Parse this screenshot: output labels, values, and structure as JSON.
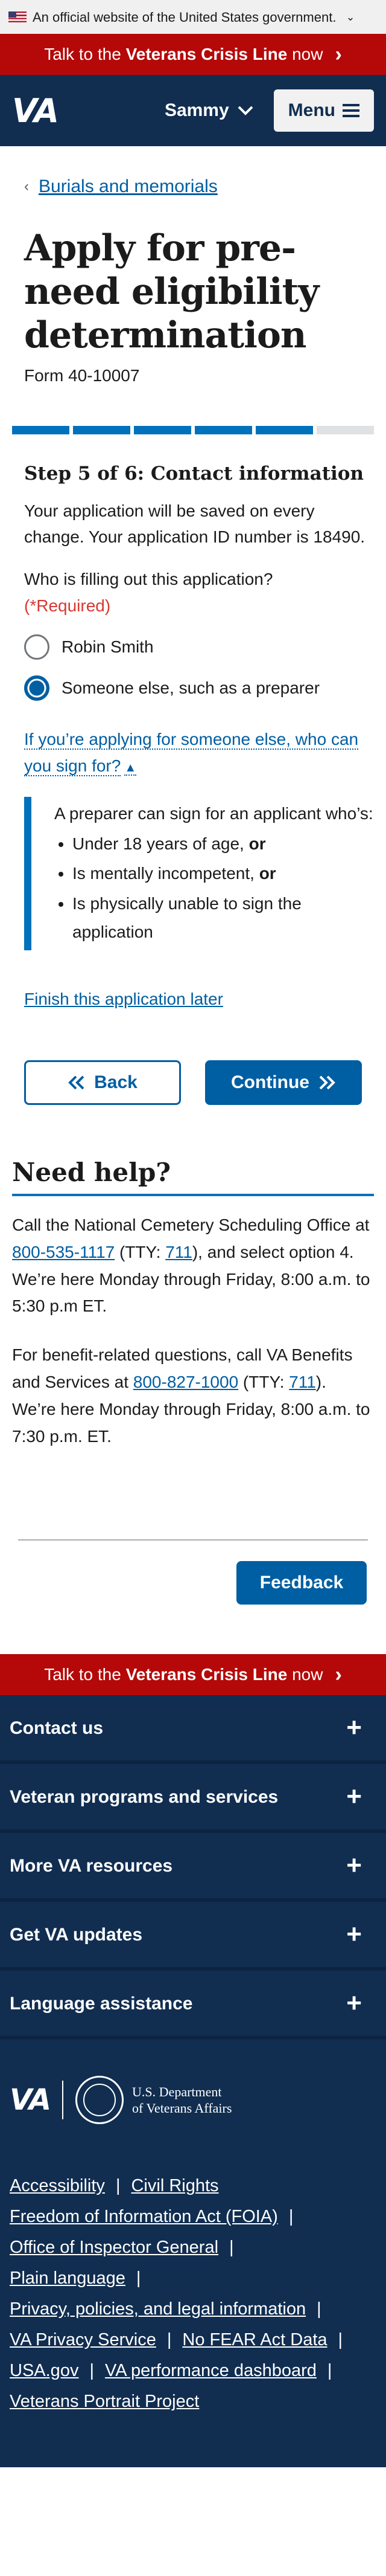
{
  "gov_banner": {
    "text": "An official website of the United States government."
  },
  "crisis": {
    "prefix": "Talk to the ",
    "strong": "Veterans Crisis Line",
    "suffix": " now"
  },
  "header": {
    "logo": "VA",
    "user_name": "Sammy",
    "menu_label": "Menu"
  },
  "breadcrumb": {
    "label": "Burials and memorials"
  },
  "page": {
    "title": "Apply for pre-need eligibility determination",
    "form_number": "Form 40-10007",
    "progress": {
      "current": 5,
      "total": 6
    },
    "step_heading": "Step 5 of 6: Contact information",
    "saved_text": "Your application will be saved on every change. Your application ID number is 18490.",
    "question": "Who is filling out this application?",
    "required": "(*Required)",
    "options": [
      "Robin Smith",
      "Someone else, such as a preparer"
    ],
    "selected_option": 1,
    "expander_label": "If you’re applying for someone else, who can you sign for?",
    "info": {
      "intro": "A preparer can sign for an applicant who’s:",
      "items": [
        {
          "text": "Under 18 years of age, ",
          "strong": "or"
        },
        {
          "text": "Is mentally incompetent, ",
          "strong": "or"
        },
        {
          "text": "Is physically unable to sign the application",
          "strong": ""
        }
      ]
    },
    "finish_later": "Finish this application later",
    "back_label": "Back",
    "continue_label": "Continue"
  },
  "help": {
    "title": "Need help?",
    "p1_a": "Call the National Cemetery Scheduling Office at ",
    "p1_phone": "800-535-1117",
    "p1_b": " (TTY: ",
    "p1_tty": "711",
    "p1_c": "), and select option 4. We’re here Monday through Friday, 8:00 a.m. to 5:30 p.m ET.",
    "p2_a": "For benefit-related questions, call VA Benefits and Services at ",
    "p2_phone": "800-827-1000",
    "p2_b": " (TTY: ",
    "p2_tty": "711",
    "p2_c": "). We’re here Monday through Friday, 8:00 a.m. to 7:30 p.m. ET."
  },
  "feedback_label": "Feedback",
  "footer": {
    "accordions": [
      "Contact us",
      "Veteran programs and services",
      "More VA resources",
      "Get VA updates",
      "Language assistance"
    ],
    "dept_line1": "U.S. Department",
    "dept_line2": "of Veterans Affairs",
    "links": {
      "accessibility": "Accessibility",
      "civil_rights": "Civil Rights",
      "foia": "Freedom of Information Act (FOIA)",
      "oig": "Office of Inspector General",
      "plain_language": "Plain language",
      "privacy_policies": "Privacy, policies, and legal information",
      "privacy_service": "VA Privacy Service",
      "no_fear": "No FEAR Act Data",
      "usa_gov": "USA.gov",
      "dashboard": "VA performance dashboard",
      "portrait": "Veterans Portrait Project"
    }
  },
  "colors": {
    "primary": "#005ea2",
    "header": "#112e51",
    "crisis": "#b50909",
    "required": "#d83933"
  }
}
